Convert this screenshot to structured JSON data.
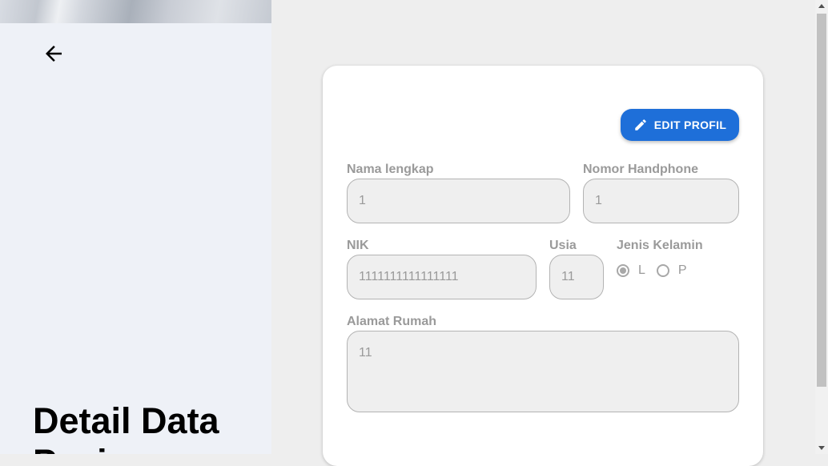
{
  "page": {
    "title": "Detail Data Pasien"
  },
  "toolbar": {
    "edit_label": "EDIT PROFIL"
  },
  "form": {
    "nama_label": "Nama lengkap",
    "nama_value": "1",
    "hp_label": "Nomor Handphone",
    "hp_value": "1",
    "nik_label": "NIK",
    "nik_value": "1111111111111111",
    "usia_label": "Usia",
    "usia_value": "11",
    "gender_label": "Jenis Kelamin",
    "gender_options": [
      "L",
      "P"
    ],
    "gender_selected": "L",
    "alamat_label": "Alamat Rumah",
    "alamat_value": "11"
  },
  "icons": {
    "back": "arrow-left-icon",
    "edit": "pencil-icon"
  },
  "colors": {
    "accent": "#1e6fd9",
    "left_panel_bg": "#eef1f7",
    "page_bg": "#eeeeee"
  }
}
